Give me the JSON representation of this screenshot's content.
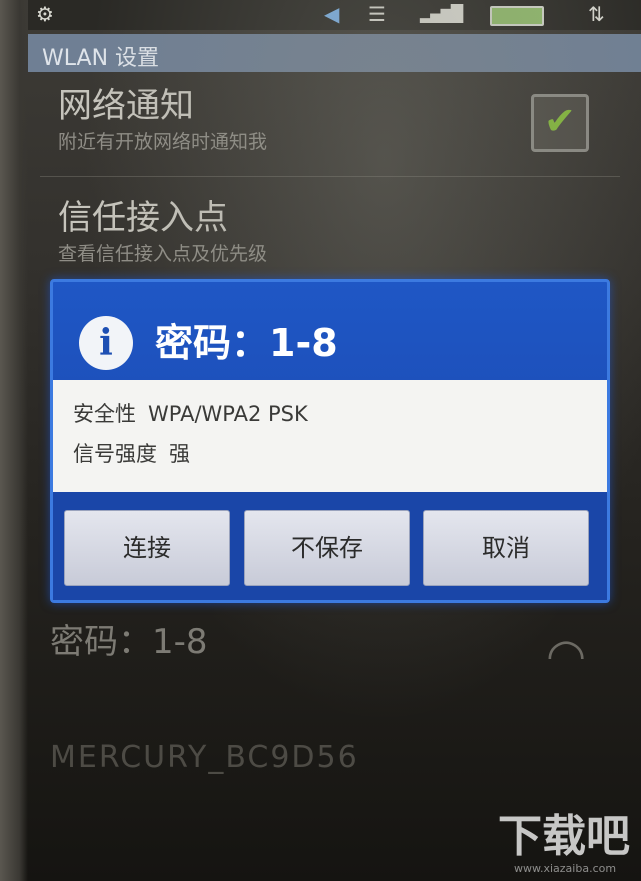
{
  "status_bar": {
    "app_icon": "gear-icon",
    "volume_icon": "speaker-icon",
    "wifi_icon": "wifi-icon",
    "signal_icon": "signal-bars-icon",
    "battery_icon": "battery-icon",
    "arrows_icon": "data-arrows-icon"
  },
  "header": {
    "title": "WLAN 设置"
  },
  "settings": {
    "network_notify": {
      "title": "网络通知",
      "summary": "附近有开放网络时通知我",
      "checked": true
    },
    "trusted_ap": {
      "title": "信任接入点",
      "summary": "查看信任接入点及优先级"
    }
  },
  "network_list": {
    "item_1": {
      "name": "密码：1-8"
    },
    "item_2": {
      "name": "MERCURY_BC9D56"
    }
  },
  "dialog": {
    "title": "密码：1-8",
    "security_label": "安全性",
    "security_value": "WPA/WPA2 PSK",
    "signal_label": "信号强度",
    "signal_value": "强",
    "buttons": {
      "connect": "连接",
      "forget": "不保存",
      "cancel": "取消"
    }
  },
  "watermark": {
    "logo": "下载吧",
    "url": "www.xiazaiba.com"
  },
  "colors": {
    "dialog_blue": "#1f57c5",
    "header_bar": "#6f7f94",
    "check_green": "#83b83a"
  }
}
